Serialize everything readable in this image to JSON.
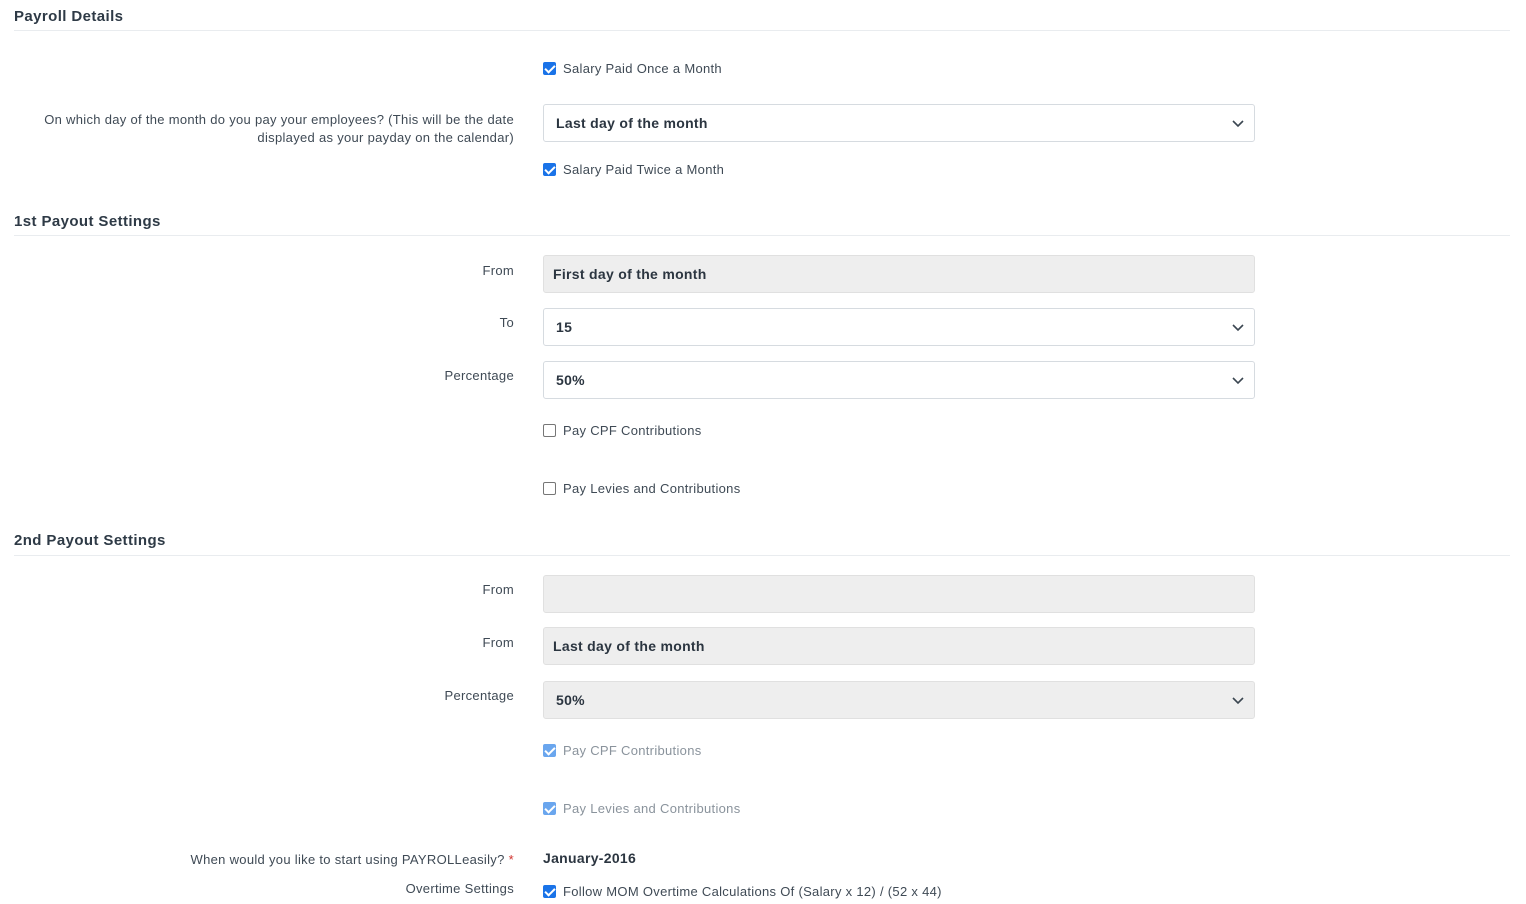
{
  "payroll_details": {
    "title": "Payroll Details",
    "once_a_month": {
      "label": "Salary Paid Once a Month",
      "checked": true
    },
    "payday_question": "On which day of the month do you pay your employees? (This will be the date displayed as your payday on the calendar)",
    "payday_value": "Last day of the month",
    "twice_a_month": {
      "label": "Salary Paid Twice a Month",
      "checked": true
    }
  },
  "first_payout": {
    "title": "1st Payout Settings",
    "from_label": "From",
    "from_value": "First day of the month",
    "to_label": "To",
    "to_value": "15",
    "percentage_label": "Percentage",
    "percentage_value": "50%",
    "cpf": {
      "label": "Pay CPF Contributions",
      "checked": false
    },
    "levies": {
      "label": "Pay Levies and Contributions",
      "checked": false
    }
  },
  "second_payout": {
    "title": "2nd Payout Settings",
    "from_label": "From",
    "from_value": "",
    "from2_label": "From",
    "from2_value": "Last day of the month",
    "percentage_label": "Percentage",
    "percentage_value": "50%",
    "cpf": {
      "label": "Pay CPF Contributions",
      "checked": true
    },
    "levies": {
      "label": "Pay Levies and Contributions",
      "checked": true
    }
  },
  "start": {
    "label": "When would you like to start using PAYROLLeasily?",
    "required_mark": "*",
    "value": "January-2016"
  },
  "overtime": {
    "label": "Overtime Settings",
    "option": {
      "label": "Follow MOM Overtime Calculations Of (Salary x 12) / (52 x 44)",
      "checked": true
    }
  },
  "colors": {
    "accent": "#1a73e8",
    "required": "#d0312d",
    "disabled_bg": "#eeeeee"
  },
  "icons": {
    "select_arrow": "chevron-down-icon"
  }
}
